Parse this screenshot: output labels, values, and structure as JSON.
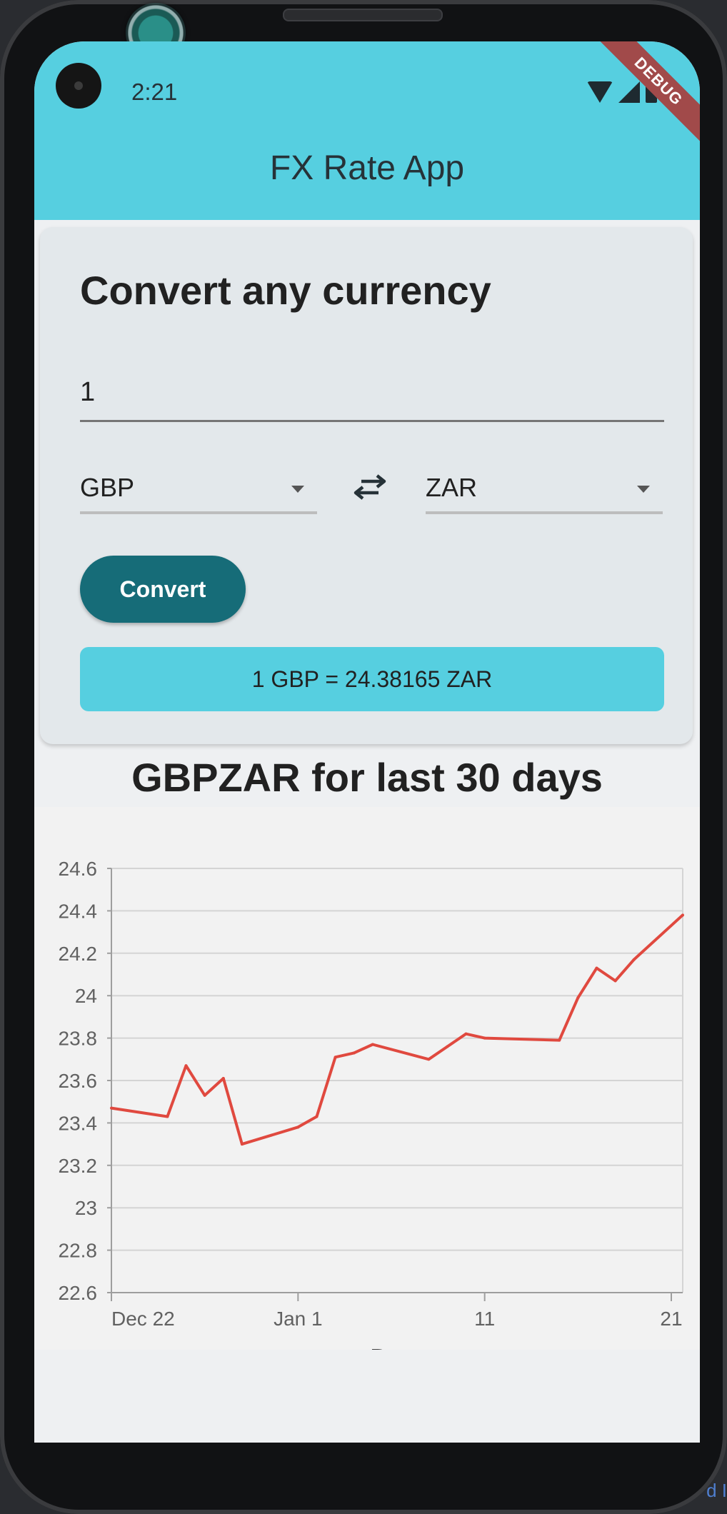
{
  "status_bar": {
    "time": "2:21",
    "debug_label": "DEBUG"
  },
  "app_bar": {
    "title": "FX Rate App"
  },
  "converter": {
    "heading": "Convert any currency",
    "amount": "1",
    "from_currency": "GBP",
    "to_currency": "ZAR",
    "convert_label": "Convert",
    "result_text": "1 GBP = 24.38165 ZAR"
  },
  "chart_title": "GBPZAR for last 30 days",
  "chart_data": {
    "type": "line",
    "title": "GBPZAR for last 30 days",
    "xlabel": "Date",
    "ylabel": "",
    "ylim": [
      22.6,
      24.6
    ],
    "yticks": [
      "24.6",
      "24.4",
      "24.2",
      "24",
      "23.8",
      "23.6",
      "23.4",
      "23.2",
      "23",
      "22.8",
      "22.6"
    ],
    "xticks": [
      "Dec 22",
      "Jan 1",
      "11",
      "21"
    ],
    "grid": true,
    "line_color": "#e0493f",
    "x": [
      "2023-12-22",
      "2023-12-25",
      "2023-12-26",
      "2023-12-27",
      "2023-12-28",
      "2023-12-29",
      "2024-01-01",
      "2024-01-02",
      "2024-01-03",
      "2024-01-04",
      "2024-01-05",
      "2024-01-08",
      "2024-01-09",
      "2024-01-10",
      "2024-01-11",
      "2024-01-15",
      "2024-01-16",
      "2024-01-17",
      "2024-01-18",
      "2024-01-19",
      "2024-01-22"
    ],
    "values": [
      23.47,
      23.43,
      23.67,
      23.53,
      23.61,
      23.3,
      23.38,
      23.43,
      23.71,
      23.73,
      23.77,
      23.7,
      23.76,
      23.82,
      23.8,
      23.79,
      23.99,
      24.13,
      24.07,
      24.17,
      24.38
    ]
  },
  "misc": {
    "edge_glyph": "d I"
  }
}
